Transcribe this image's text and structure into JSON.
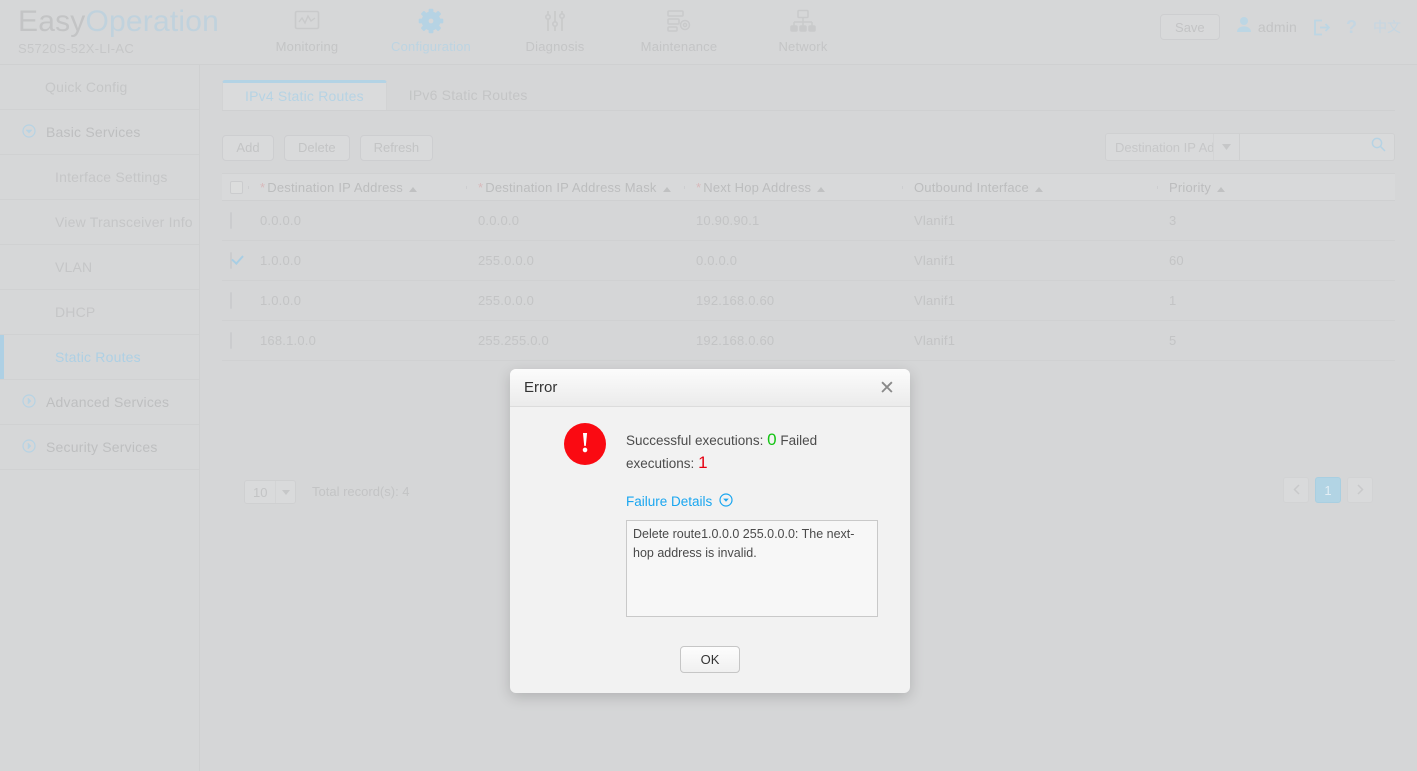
{
  "header": {
    "brand_easy": "Easy",
    "brand_operation": "Operation",
    "device_model": "S5720S-52X-LI-AC",
    "nav": [
      {
        "label": "Monitoring",
        "icon": "monitor-icon",
        "active": false
      },
      {
        "label": "Configuration",
        "icon": "gear-icon",
        "active": true
      },
      {
        "label": "Diagnosis",
        "icon": "sliders-icon",
        "active": false
      },
      {
        "label": "Maintenance",
        "icon": "server-gear-icon",
        "active": false
      },
      {
        "label": "Network",
        "icon": "network-topology-icon",
        "active": false
      }
    ],
    "save_label": "Save",
    "user_name": "admin",
    "logout_icon": "logout-icon",
    "help_icon": "help-icon",
    "language_label": "中文"
  },
  "sidebar": {
    "items": [
      {
        "label": "Quick Config",
        "level": 2,
        "active": false,
        "arrow": ""
      },
      {
        "label": "Basic Services",
        "level": 1,
        "active": false,
        "arrow": "down"
      },
      {
        "label": "Interface Settings",
        "level": 2,
        "active": false,
        "arrow": ""
      },
      {
        "label": "View Transceiver Info",
        "level": 2,
        "active": false,
        "arrow": ""
      },
      {
        "label": "VLAN",
        "level": 2,
        "active": false,
        "arrow": ""
      },
      {
        "label": "DHCP",
        "level": 2,
        "active": false,
        "arrow": ""
      },
      {
        "label": "Static Routes",
        "level": 2,
        "active": true,
        "arrow": ""
      },
      {
        "label": "Advanced Services",
        "level": 1,
        "active": false,
        "arrow": "right"
      },
      {
        "label": "Security Services",
        "level": 1,
        "active": false,
        "arrow": "right"
      }
    ]
  },
  "main": {
    "tabs": [
      {
        "label": "IPv4 Static Routes",
        "active": true
      },
      {
        "label": "IPv6 Static Routes",
        "active": false
      }
    ],
    "toolbar": {
      "add_label": "Add",
      "delete_label": "Delete",
      "refresh_label": "Refresh",
      "search_field_label": "Destination IP Add",
      "search_value": "",
      "search_placeholder": "",
      "search_icon": "search-icon",
      "caret_icon": "chevron-down-icon"
    },
    "table": {
      "columns": [
        {
          "label": "Destination IP Address",
          "required": true,
          "sortable": true
        },
        {
          "label": "Destination IP Address Mask",
          "required": true,
          "sortable": true
        },
        {
          "label": "Next Hop Address",
          "required": true,
          "sortable": true
        },
        {
          "label": "Outbound Interface",
          "required": false,
          "sortable": true
        },
        {
          "label": "Priority",
          "required": false,
          "sortable": true
        }
      ],
      "rows": [
        {
          "checked": false,
          "destination": "0.0.0.0",
          "mask": "0.0.0.0",
          "next_hop": "10.90.90.1",
          "interface": "Vlanif1",
          "priority": "3"
        },
        {
          "checked": true,
          "destination": "1.0.0.0",
          "mask": "255.0.0.0",
          "next_hop": "0.0.0.0",
          "interface": "Vlanif1",
          "priority": "60"
        },
        {
          "checked": false,
          "destination": "1.0.0.0",
          "mask": "255.0.0.0",
          "next_hop": "192.168.0.60",
          "interface": "Vlanif1",
          "priority": "1"
        },
        {
          "checked": false,
          "destination": "168.1.0.0",
          "mask": "255.255.0.0",
          "next_hop": "192.168.0.60",
          "interface": "Vlanif1",
          "priority": "5"
        }
      ]
    },
    "footer": {
      "page_size": "10",
      "total_label": "Total record(s): 4",
      "prev_icon": "chevron-left-icon",
      "next_icon": "chevron-right-icon",
      "current_page": "1"
    }
  },
  "dialog": {
    "title": "Error",
    "close_icon": "close-icon",
    "status_icon": "error-exclamation-icon",
    "success_label": "Successful executions:",
    "success_count": "0",
    "failed_label": "Failed executions:",
    "failed_count": "1",
    "details_link_label": "Failure Details",
    "details_toggle_icon": "chevron-down-circle-icon",
    "details_text": "Delete route1.0.0.0 255.0.0.0: The next-hop address is invalid.",
    "ok_label": "OK"
  },
  "colors": {
    "accent_blue": "#1aa6f0",
    "error_red": "#fa0a12",
    "success_green": "#14c414",
    "page_bg": "#d5d6d7",
    "dialog_bg": "#f2f2f2"
  }
}
